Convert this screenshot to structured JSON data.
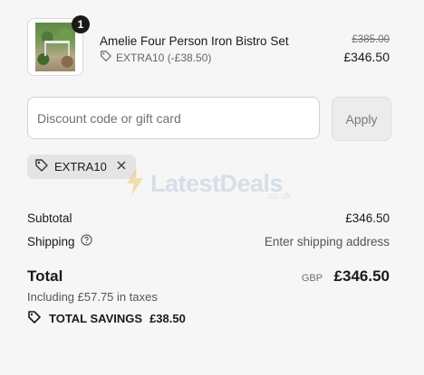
{
  "item": {
    "quantity": "1",
    "name": "Amelie Four Person Iron Bistro Set",
    "discount_line": "EXTRA10 (-£38.50)",
    "original_price": "£385.00",
    "price": "£346.50"
  },
  "discount_form": {
    "placeholder": "Discount code or gift card",
    "apply_label": "Apply"
  },
  "applied_code": "EXTRA10",
  "watermark": {
    "brand": "LatestDeals",
    "domain": ".co.uk"
  },
  "summary": {
    "subtotal_label": "Subtotal",
    "subtotal_value": "£346.50",
    "shipping_label": "Shipping",
    "shipping_value": "Enter shipping address",
    "total_label": "Total",
    "currency": "GBP",
    "total_value": "£346.50",
    "taxes": "Including £57.75 in taxes",
    "savings_label": "TOTAL SAVINGS",
    "savings_value": "£38.50"
  },
  "icons": {
    "tag": "tag-icon",
    "remove": "close-icon",
    "help": "help-circle-icon",
    "bolt": "bolt-icon"
  }
}
